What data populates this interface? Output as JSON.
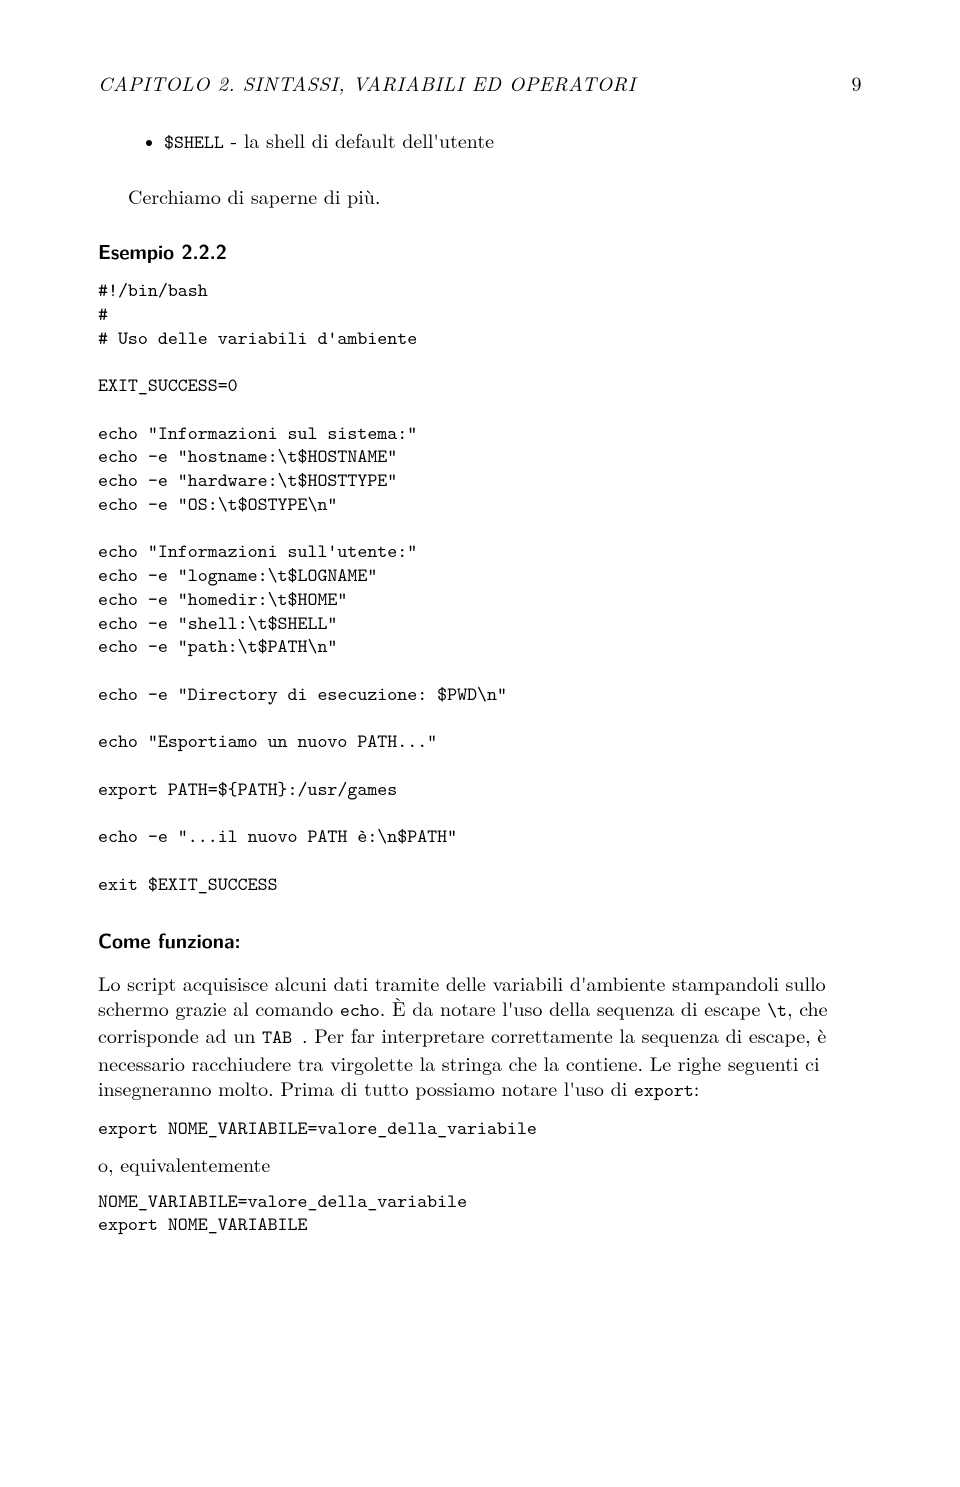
{
  "header": {
    "title": "CAPITOLO 2.  SINTASSI, VARIABILI ED OPERATORI",
    "page_number": "9"
  },
  "bullet": {
    "prefix": "$SHELL",
    "text": " - la shell di default dell'utente"
  },
  "intro_sentence": "Cerchiamo di saperne di più.",
  "example_label": "Esempio 2.2.2",
  "code_block_1": "#!/bin/bash\n#\n# Uso delle variabili d'ambiente\n\nEXIT_SUCCESS=0\n\necho \"Informazioni sul sistema:\"\necho -e \"hostname:\\t$HOSTNAME\"\necho -e \"hardware:\\t$HOSTTYPE\"\necho -e \"OS:\\t$OSTYPE\\n\"\n\necho \"Informazioni sull'utente:\"\necho -e \"logname:\\t$LOGNAME\"\necho -e \"homedir:\\t$HOME\"\necho -e \"shell:\\t$SHELL\"\necho -e \"path:\\t$PATH\\n\"\n\necho -e \"Directory di esecuzione: $PWD\\n\"\n\necho \"Esportiamo un nuovo PATH...\"\n\nexport PATH=${PATH}:/usr/games\n\necho -e \"...il nuovo PATH è:\\n$PATH\"\n\nexit $EXIT_SUCCESS",
  "come_funziona_label": "Come funziona:",
  "explanation": {
    "s1": "Lo script acquisisce alcuni dati tramite delle variabili d'ambiente stampandoli sullo schermo grazie al comando ",
    "tt1": "echo",
    "s2": ". È da notare l'uso della sequenza di escape ",
    "tt_escape": "\\t",
    "s3": ", che corrisponde ad un ",
    "tt2": "TAB ",
    "s4": ". Per far interpretare correttamente la sequenza di escape, è necessario racchiudere tra virgolette la stringa che la contiene. Le righe seguenti ci insegneranno molto. Prima di tutto possiamo notare l'uso di ",
    "tt3": "export",
    "s5": ":"
  },
  "code_block_2": "export NOME_VARIABILE=valore_della_variabile",
  "equiv_text": "o, equivalentemente",
  "code_block_3": "NOME_VARIABILE=valore_della_variabile\nexport NOME_VARIABILE"
}
